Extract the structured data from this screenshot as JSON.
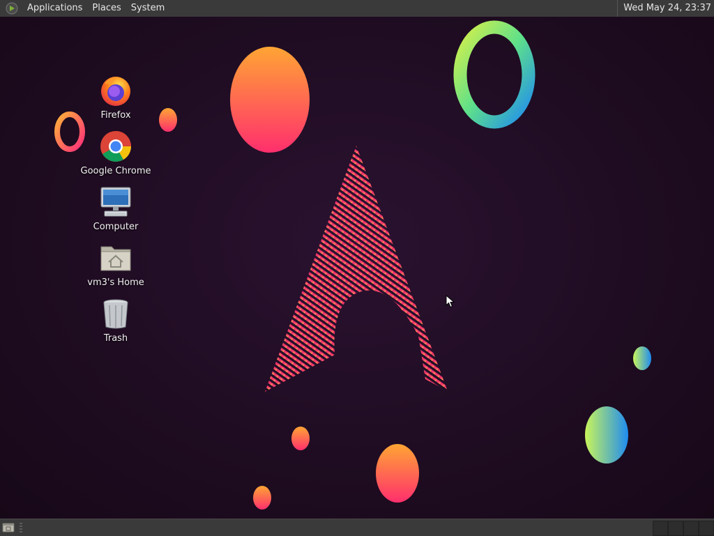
{
  "top_panel": {
    "logo_icon": "mate-menu-icon",
    "menus": [
      "Applications",
      "Places",
      "System"
    ],
    "clock": "Wed May 24, 23:37"
  },
  "desktop_icons": [
    {
      "label": "Firefox",
      "icon": "firefox-icon"
    },
    {
      "label": "Google Chrome",
      "icon": "chrome-icon"
    },
    {
      "label": "Computer",
      "icon": "computer-icon"
    },
    {
      "label": "vm3's Home",
      "icon": "home-folder-icon"
    },
    {
      "label": "Trash",
      "icon": "trash-icon"
    }
  ],
  "bottom_panel": {
    "show_desktop_icon": "show-desktop-icon",
    "workspaces": 4
  },
  "colors": {
    "panel": "#3a3a3a",
    "desktop_bg": "#1f0c22",
    "accent_pink": "#e8246c",
    "accent_orange": "#ff9a3c"
  }
}
